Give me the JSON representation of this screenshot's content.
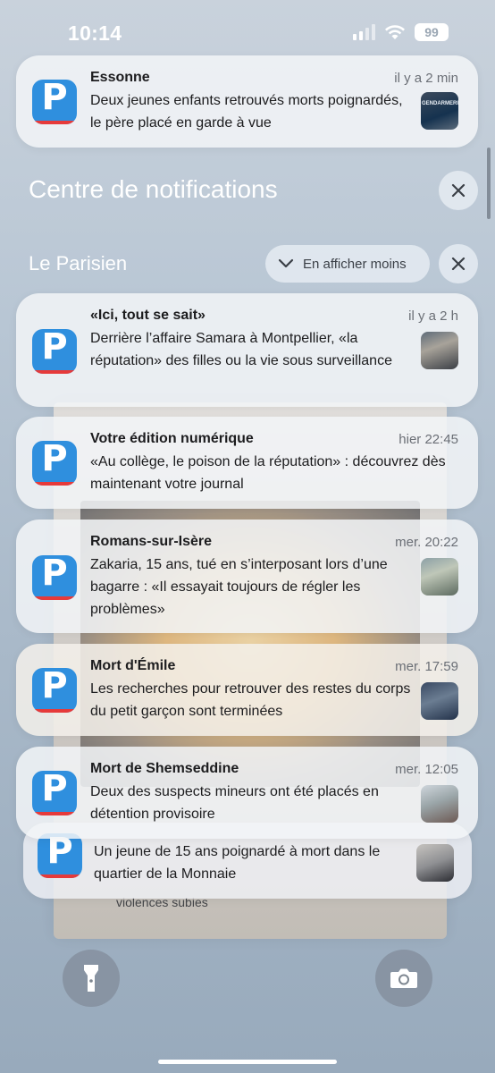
{
  "status_bar": {
    "time": "10:14",
    "battery": "99"
  },
  "top_notification": {
    "title": "Essonne",
    "time": "il y a 2 min",
    "body": "Deux jeunes enfants retrouvés morts poignardés, le père placé en garde à vue",
    "thumb_text": "GENDARMERIE"
  },
  "center": {
    "title": "Centre de notifications",
    "close_icon": "close-icon"
  },
  "group": {
    "app_name": "Le Parisien",
    "show_less_label": "En afficher moins",
    "accent": "#2f8fde"
  },
  "notifications": [
    {
      "title": "«Ici, tout se sait»",
      "time": "il y a 2 h",
      "body": "Derrière l’affaire Samara à Montpellier, «la réputation» des filles ou la vie sous surveillance",
      "has_thumb": true
    },
    {
      "title": "Votre édition numérique",
      "time": "hier 22:45",
      "body": "«Au collège, le poison de la réputation» : découvrez dès maintenant votre journal",
      "has_thumb": false
    },
    {
      "title": "Romans-sur-Isère",
      "time": "mer. 20:22",
      "body": "Zakaria, 15 ans, tué en s’interposant lors d’une bagarre : «Il essayait toujours de régler les problèmes»",
      "has_thumb": true
    },
    {
      "title": "Mort d'Émile",
      "time": "mer. 17:59",
      "body": "Les recherches pour retrouver des restes du corps du petit garçon sont terminées",
      "has_thumb": true
    },
    {
      "title": "Mort de Shemseddine",
      "time": "mer. 12:05",
      "body": "Deux des suspects mineurs ont été placés en détention provisoire",
      "has_thumb": true
    },
    {
      "title": "",
      "time": "",
      "body": "Un jeune de 15 ans poignardé à mort dans le quartier de la Monnaie",
      "has_thumb": true
    }
  ],
  "wallpaper_caption": "violences subies",
  "bottom": {
    "left_icon": "flashlight-icon",
    "right_icon": "camera-icon"
  }
}
